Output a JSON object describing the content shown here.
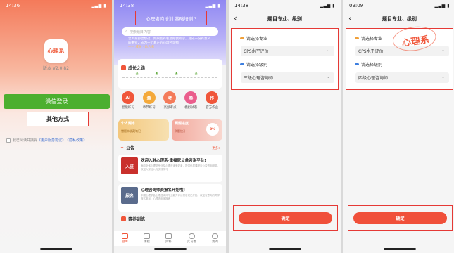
{
  "phones": {
    "login": {
      "status_time": "14:36",
      "logo_text": "心理系",
      "version": "版本 V2.0.82",
      "wechat_login": "微信登录",
      "other_methods": "其他方式",
      "agreement_prefix": "我已阅读并接受",
      "agreement_user": "《用户服务协议》",
      "agreement_privacy": "《隐私政策》"
    },
    "home": {
      "status_time": "14:38",
      "title": "心理咨询培训 基础培训",
      "search_placeholder": "搜索题目内容",
      "banner_text": "曾大家都曾想过，如果能有机会把我所学，变成一份有意义的事业，成为一个真正的心理咨询师",
      "banner_sign": "—— 成长 · 助人者",
      "growth_title": "成长之路",
      "categories": [
        {
          "label": "智能练习",
          "icon": "AI",
          "color": "#f0563a"
        },
        {
          "label": "章节练习",
          "icon": "章",
          "color": "#f4a93b"
        },
        {
          "label": "高频考点",
          "icon": "考",
          "color": "#f47b5a"
        },
        {
          "label": "模拟试卷",
          "icon": "卷",
          "color": "#ea5d8c"
        },
        {
          "label": "官方作业",
          "icon": "作",
          "color": "#f0563a"
        }
      ],
      "card_personal_title": "个人题本",
      "card_personal_sub": "错题本收藏笔记",
      "card_progress_title": "刷题进度",
      "card_progress_sub": "刷题统计",
      "card_progress_pct": "0%",
      "notice_title": "公告",
      "notice_more": "更多>",
      "notices": [
        {
          "title": "欢迎入驻心理系·幸福家公益咨询平台!",
          "desc": "面向全体心理学专业及心理咨询爱好者，提供优质课程与公益咨询服务，欢迎大家加入与交流学习",
          "thumb": "入驻",
          "color": "#c9302c"
        },
        {
          "title": "心理咨询师资报名开始啦!",
          "desc": "中国心理学会心理咨询师专业能力评价报名现已开始，欢迎有意向的同学报名参加，心理咨询师报考",
          "thumb": "报名",
          "color": "#5a6b8c"
        }
      ],
      "section_training": "素养训练",
      "tabs": [
        "题库",
        "课程",
        "资料",
        "实习圈",
        "我的"
      ]
    },
    "select_a": {
      "status_time": "14:38",
      "nav_title": "题目专业、级别",
      "major_label": "请选择专业",
      "major_value": "CPS水平评价",
      "level_label": "请选择级别",
      "level_value": "三级心理咨询师",
      "confirm": "确定"
    },
    "select_b": {
      "status_time": "09:09",
      "nav_title": "题目专业、级别",
      "major_label": "请选择专业",
      "major_value": "CPS水平评价",
      "level_label": "请选择级别",
      "level_value": "四级心理咨询师",
      "confirm": "确定",
      "watermark": "心理系"
    }
  },
  "colors": {
    "accent": "#f0563a",
    "highlight_box": "#e53935",
    "wechat": "#4caf2f",
    "header_purple": "#9088f2"
  }
}
